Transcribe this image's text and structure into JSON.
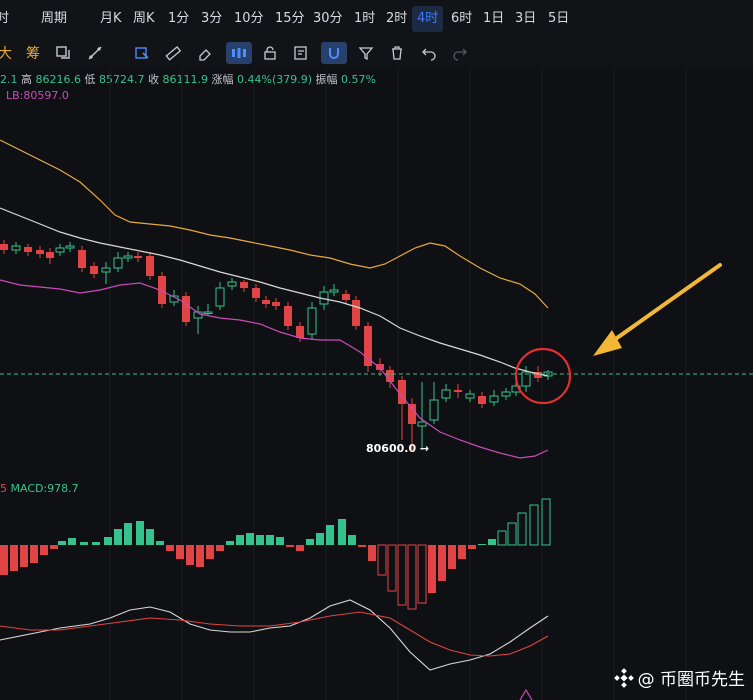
{
  "toolbar_tf": {
    "items": [
      {
        "label": "分时"
      },
      {
        "label": "周期"
      },
      {
        "label": "月K"
      },
      {
        "label": "周K"
      },
      {
        "label": "1分"
      },
      {
        "label": "3分"
      },
      {
        "label": "10分"
      },
      {
        "label": "15分"
      },
      {
        "label": "30分"
      },
      {
        "label": "1时"
      },
      {
        "label": "2时"
      },
      {
        "label": "4时"
      },
      {
        "label": "6时"
      },
      {
        "label": "1日"
      },
      {
        "label": "3日"
      },
      {
        "label": "5日"
      }
    ],
    "active": "4时"
  },
  "drawing_tools": [
    "大",
    "筹",
    "replace-icon",
    "pen-ruler-icon",
    "cursor-square-icon",
    "ruler-icon",
    "eraser-icon",
    "candles-icon",
    "lock-icon",
    "edit-list-icon",
    "magnet-icon",
    "filter-icon",
    "trash-icon",
    "undo-icon",
    "redo-icon"
  ],
  "info": {
    "open_tail": "2.1",
    "high_label": "高",
    "high": "86216.6",
    "low_label": "低",
    "low": "85724.7",
    "close_label": "收",
    "close": "86111.9",
    "change_label": "涨幅",
    "change": "0.44%(379.9)",
    "amp_label": "振幅",
    "amp": "0.57%",
    "lb": "LB:80597.0"
  },
  "macd": {
    "prefix": "5",
    "label": "MACD:978.7"
  },
  "annotations": {
    "low_marker": "80600.0 →"
  },
  "watermark": {
    "text": "@ 币圈币先生"
  },
  "colors": {
    "up": "#36c28d",
    "down": "#e04444",
    "upper_band": "#e8a93b",
    "middle_band": "#d9d9d9",
    "lower_band": "#c94bb9",
    "arrow": "#f2b736",
    "circle": "#e03030"
  }
}
